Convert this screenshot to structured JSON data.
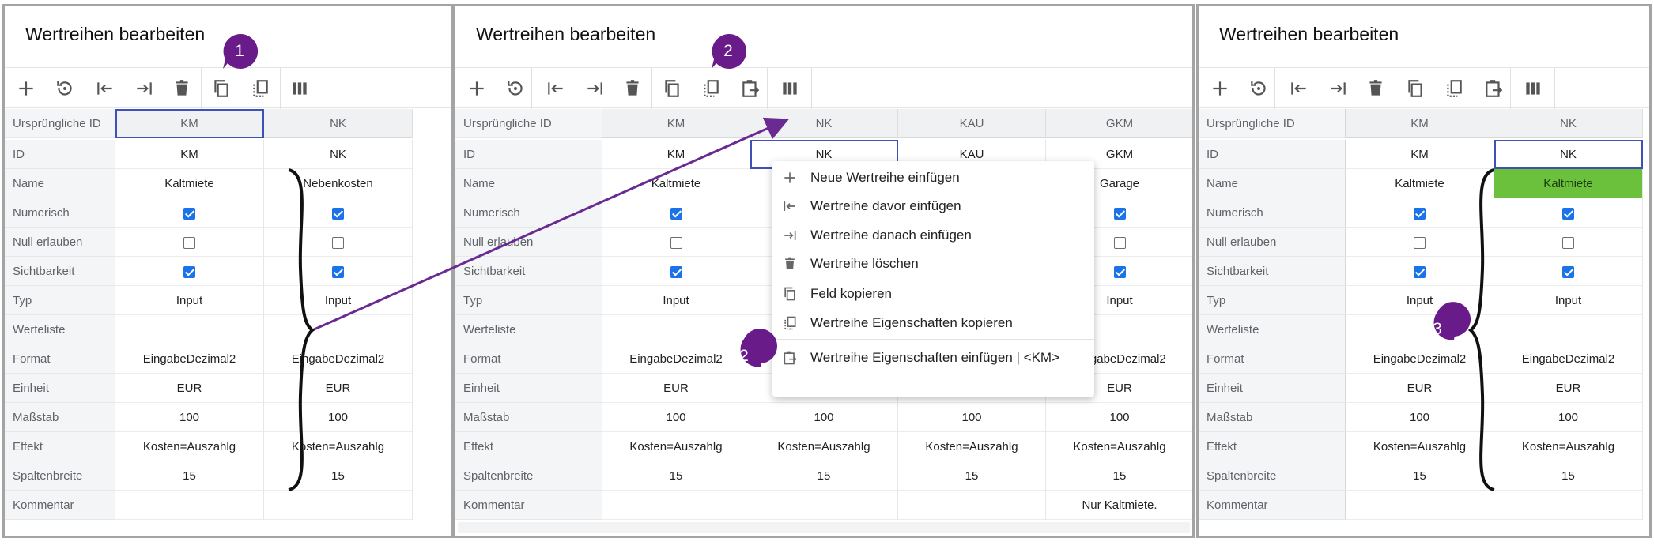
{
  "panels": [
    {
      "title": "Wertreihen bearbeiten",
      "row_labels": [
        "Ursprüngliche ID",
        "ID",
        "Name",
        "Numerisch",
        "Null erlauben",
        "Sichtbarkeit",
        "Typ",
        "Werteliste",
        "Format",
        "Einheit",
        "Maßstab",
        "Effekt",
        "Spaltenbreite",
        "Kommentar"
      ],
      "columns": [
        {
          "header": "KM",
          "values": [
            "KM",
            "Kaltmiete",
            "",
            "",
            "",
            "Input",
            "",
            "EingabeDezimal2",
            "EUR",
            "100",
            "Kosten=Auszahlg",
            "15",
            ""
          ],
          "checks": [
            true,
            false,
            true
          ]
        },
        {
          "header": "NK",
          "values": [
            "NK",
            "Nebenkosten",
            "",
            "",
            "",
            "Input",
            "",
            "EingabeDezimal2",
            "EUR",
            "100",
            "Kosten=Auszahlg",
            "15",
            ""
          ],
          "checks": [
            true,
            false,
            true
          ]
        }
      ]
    },
    {
      "title": "Wertreihen bearbeiten",
      "row_labels": [
        "Ursprüngliche ID",
        "ID",
        "Name",
        "Numerisch",
        "Null erlauben",
        "Sichtbarkeit",
        "Typ",
        "Werteliste",
        "Format",
        "Einheit",
        "Maßstab",
        "Effekt",
        "Spaltenbreite",
        "Kommentar"
      ],
      "columns": [
        {
          "header": "KM",
          "values": [
            "KM",
            "Kaltmiete",
            "",
            "",
            "",
            "Input",
            "",
            "EingabeDezimal2",
            "EUR",
            "100",
            "Kosten=Auszahlg",
            "15",
            ""
          ],
          "checks": [
            true,
            false,
            true
          ]
        },
        {
          "header": "NK",
          "values": [
            "NK",
            "",
            "",
            "",
            "",
            "",
            "",
            "",
            "",
            "100",
            "Kosten=Auszahlg",
            "15",
            ""
          ],
          "checks": [
            null,
            null,
            null
          ]
        },
        {
          "header": "KAU",
          "values": [
            "KAU",
            "",
            "",
            "",
            "",
            "",
            "",
            "",
            "",
            "100",
            "Kosten=Auszahlg",
            "15",
            ""
          ],
          "checks": [
            null,
            null,
            null
          ]
        },
        {
          "header": "GKM",
          "values": [
            "GKM",
            "Garage",
            "",
            "",
            "",
            "Input",
            "",
            "EingabeDezimal2",
            "EUR",
            "100",
            "Kosten=Auszahlg",
            "15",
            "Nur Kaltmiete."
          ],
          "checks": [
            true,
            false,
            true
          ]
        }
      ]
    },
    {
      "title": "Wertreihen bearbeiten",
      "row_labels": [
        "Ursprüngliche ID",
        "ID",
        "Name",
        "Numerisch",
        "Null erlauben",
        "Sichtbarkeit",
        "Typ",
        "Werteliste",
        "Format",
        "Einheit",
        "Maßstab",
        "Effekt",
        "Spaltenbreite",
        "Kommentar"
      ],
      "columns": [
        {
          "header": "KM",
          "values": [
            "KM",
            "Kaltmiete",
            "",
            "",
            "",
            "Input",
            "",
            "EingabeDezimal2",
            "EUR",
            "100",
            "Kosten=Auszahlg",
            "15",
            ""
          ],
          "checks": [
            true,
            false,
            true
          ]
        },
        {
          "header": "NK",
          "values": [
            "NK",
            "Kaltmiete",
            "",
            "",
            "",
            "Input",
            "",
            "EingabeDezimal2",
            "EUR",
            "100",
            "Kosten=Auszahlg",
            "15",
            ""
          ],
          "checks": [
            true,
            false,
            true
          ]
        }
      ]
    }
  ],
  "context_menu": {
    "items": [
      {
        "label": "Neue Wertreihe einfügen",
        "icon": "plus-icon"
      },
      {
        "label": "Wertreihe davor einfügen",
        "icon": "insert-before-icon"
      },
      {
        "label": "Wertreihe danach einfügen",
        "icon": "insert-after-icon"
      },
      {
        "label": "Wertreihe löschen",
        "icon": "trash-icon"
      },
      {
        "label": "Feld kopieren",
        "icon": "copy-icon"
      },
      {
        "label": "Wertreihe Eigenschaften kopieren",
        "icon": "copy-properties-icon"
      },
      {
        "label": "Wertreihe Eigenschaften einfügen | <KM>",
        "icon": "paste-properties-icon"
      }
    ]
  },
  "badges": {
    "b1": "1",
    "b2a": "2",
    "b2b": "2",
    "b3": "3"
  },
  "colors": {
    "badge": "#6a1b8a",
    "arrow": "#6a2a91",
    "selection": "#3f51b5",
    "paste_highlight": "#6cc13c",
    "checkbox": "#1a73e8"
  }
}
